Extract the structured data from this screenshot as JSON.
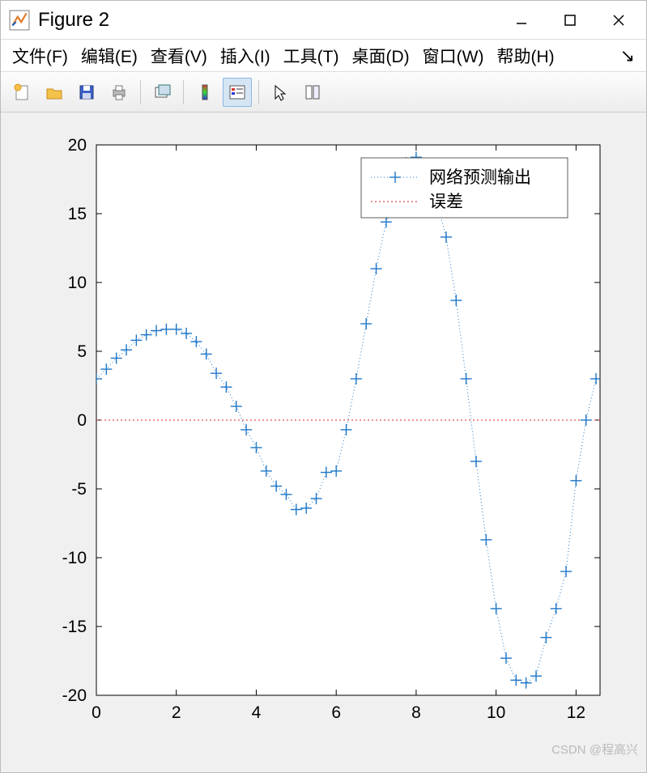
{
  "window": {
    "title": "Figure 2"
  },
  "menu": {
    "file": "文件(F)",
    "edit": "编辑(E)",
    "view": "查看(V)",
    "insert": "插入(I)",
    "tools": "工具(T)",
    "desktop": "桌面(D)",
    "window": "窗口(W)",
    "help": "帮助(H)",
    "overflow": "↘"
  },
  "toolbar": {
    "new": "new-file-icon",
    "open": "open-folder-icon",
    "save": "save-icon",
    "print": "print-icon",
    "copy_figure": "copy-figure-icon",
    "color_bar": "colorbar-icon",
    "insert_legend": "legend-icon",
    "cursor": "cursor-icon",
    "plot_tools": "plot-tools-icon"
  },
  "legend": {
    "series1": "网络预测输出",
    "series2": "误差"
  },
  "axes": {
    "xticks": [
      "0",
      "2",
      "4",
      "6",
      "8",
      "10",
      "12"
    ],
    "yticks": [
      "-20",
      "-15",
      "-10",
      "-5",
      "0",
      "5",
      "10",
      "15",
      "20"
    ]
  },
  "watermark": "CSDN @程高兴",
  "chart_data": {
    "type": "line",
    "xlabel": "",
    "ylabel": "",
    "title": "",
    "xlim": [
      0,
      12.6
    ],
    "ylim": [
      -20,
      20
    ],
    "series": [
      {
        "name": "网络预测输出",
        "style": "dotted-plus",
        "color": "#1f77c9",
        "x": [
          0.0,
          0.25,
          0.5,
          0.75,
          1.0,
          1.25,
          1.5,
          1.75,
          2.0,
          2.25,
          2.5,
          2.75,
          3.0,
          3.25,
          3.5,
          3.75,
          4.0,
          4.25,
          4.5,
          4.75,
          5.0,
          5.25,
          5.5,
          5.75,
          6.0,
          6.25,
          6.5,
          6.75,
          7.0,
          7.25,
          7.5,
          7.75,
          8.0,
          8.25,
          8.5,
          8.75,
          9.0,
          9.25,
          9.5,
          9.75,
          10.0,
          10.25,
          10.5,
          10.75,
          11.0,
          11.25,
          11.5,
          11.75,
          12.0,
          12.25,
          12.5
        ],
        "y": [
          3.0,
          3.7,
          4.5,
          5.1,
          5.8,
          6.2,
          6.5,
          6.6,
          6.6,
          6.3,
          5.7,
          4.8,
          3.4,
          2.4,
          1.0,
          -0.7,
          -2.0,
          -3.7,
          -4.8,
          -5.4,
          -6.5,
          -6.4,
          -5.7,
          -3.8,
          -3.7,
          -0.7,
          3.0,
          7.0,
          11.0,
          14.4,
          17.0,
          18.7,
          19.1,
          18.2,
          16.0,
          13.3,
          8.7,
          3.0,
          -3.0,
          -8.7,
          -13.7,
          -17.3,
          -18.9,
          -19.1,
          -18.6,
          -15.8,
          -13.7,
          -11.0,
          -4.4,
          0.0,
          3.0
        ]
      },
      {
        "name": "误差",
        "style": "dotted",
        "color": "#d62728",
        "x": [
          0.0,
          12.6
        ],
        "y": [
          0.0,
          0.0
        ]
      }
    ],
    "legend_position": "upper-right"
  }
}
